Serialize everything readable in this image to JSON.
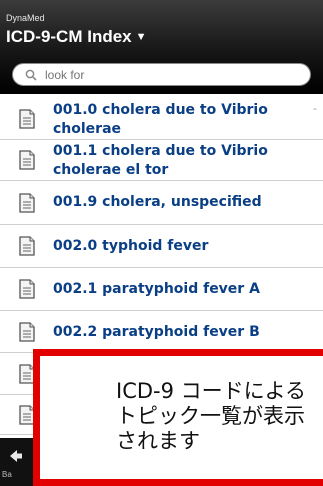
{
  "header": {
    "brand": "DynaMed",
    "title": "ICD-9-CM Index",
    "caret": "▼"
  },
  "search": {
    "placeholder": "look for",
    "icon": "search-icon"
  },
  "list": {
    "items": [
      {
        "label": "001.0 cholera due to Vibrio cholerae",
        "icon": "document-icon"
      },
      {
        "label": "001.1 cholera due to Vibrio cholerae el tor",
        "icon": "document-icon"
      },
      {
        "label": "001.9 cholera, unspecified",
        "icon": "document-icon"
      },
      {
        "label": "002.0 typhoid fever",
        "icon": "document-icon"
      },
      {
        "label": "002.1 paratyphoid fever A",
        "icon": "document-icon"
      },
      {
        "label": "002.2 paratyphoid fever B",
        "icon": "document-icon"
      }
    ]
  },
  "overlay": {
    "message": "ICD-9 コードによる\nトピック一覧が表示\nされます"
  },
  "toolbar": {
    "label": "Ba",
    "icon": "back-icon"
  },
  "colors": {
    "header_bg": "#000000",
    "link": "#0a3f86",
    "overlay_border": "#e30000"
  }
}
